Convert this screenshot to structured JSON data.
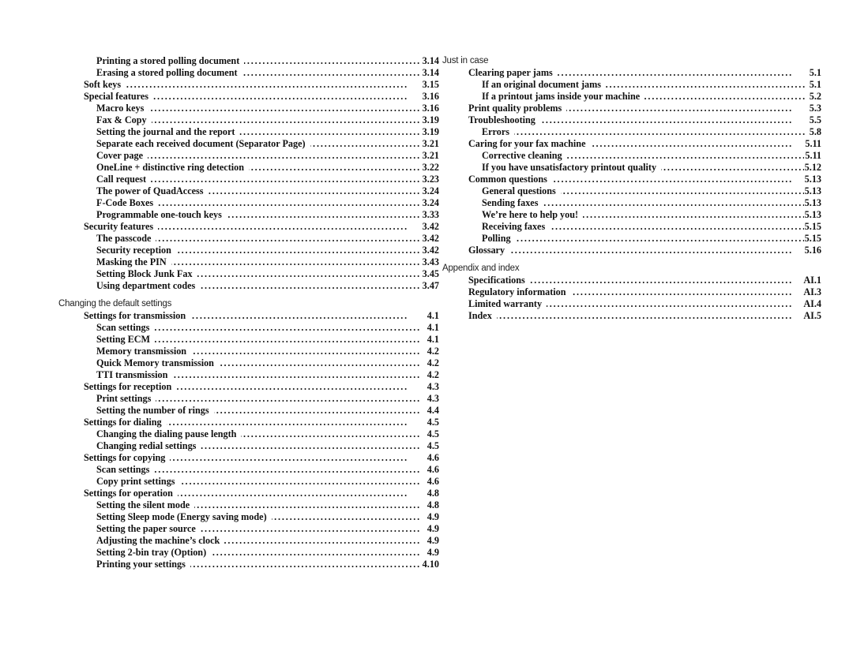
{
  "left_column": {
    "continued_entries": [
      {
        "level": 2,
        "title": "Printing a stored polling document",
        "page": "3.14"
      },
      {
        "level": 2,
        "title": "Erasing a stored polling document",
        "page": "3.14"
      },
      {
        "level": 1,
        "title": "Soft keys",
        "page": "3.15"
      },
      {
        "level": 1,
        "title": "Special features",
        "page": "3.16"
      },
      {
        "level": 2,
        "title": "Macro keys",
        "page": "3.16"
      },
      {
        "level": 2,
        "title": "Fax & Copy",
        "page": "3.19"
      },
      {
        "level": 2,
        "title": "Setting the journal and the report",
        "page": "3.19"
      },
      {
        "level": 2,
        "title": "Separate each received document (Separator Page)",
        "page": "3.21"
      },
      {
        "level": 2,
        "title": "Cover page",
        "page": "3.21"
      },
      {
        "level": 2,
        "title": "OneLine + distinctive ring detection",
        "page": "3.22"
      },
      {
        "level": 2,
        "title": "Call request",
        "page": "3.23"
      },
      {
        "level": 2,
        "title": "The power of QuadAccess",
        "page": "3.24"
      },
      {
        "level": 2,
        "title": "F-Code Boxes",
        "page": "3.24"
      },
      {
        "level": 2,
        "title": "Programmable one-touch keys",
        "page": "3.33"
      },
      {
        "level": 1,
        "title": "Security features",
        "page": "3.42"
      },
      {
        "level": 2,
        "title": "The passcode",
        "page": "3.42"
      },
      {
        "level": 2,
        "title": "Security reception",
        "page": "3.42"
      },
      {
        "level": 2,
        "title": "Masking the PIN",
        "page": "3.43"
      },
      {
        "level": 2,
        "title": "Setting Block Junk Fax",
        "page": "3.45"
      },
      {
        "level": 2,
        "title": "Using department codes",
        "page": "3.47"
      }
    ],
    "section": {
      "heading": "Changing the default settings",
      "entries": [
        {
          "level": 1,
          "title": "Settings for transmission",
          "page": "4.1"
        },
        {
          "level": 2,
          "title": "Scan settings",
          "page": "4.1"
        },
        {
          "level": 2,
          "title": "Setting ECM",
          "page": "4.1"
        },
        {
          "level": 2,
          "title": "Memory transmission",
          "page": "4.2"
        },
        {
          "level": 2,
          "title": "Quick Memory transmission",
          "page": "4.2"
        },
        {
          "level": 2,
          "title": "TTI transmission",
          "page": "4.2"
        },
        {
          "level": 1,
          "title": "Settings for reception",
          "page": "4.3"
        },
        {
          "level": 2,
          "title": "Print settings",
          "page": "4.3"
        },
        {
          "level": 2,
          "title": "Setting the number of rings",
          "page": "4.4"
        },
        {
          "level": 1,
          "title": "Settings for dialing",
          "page": "4.5"
        },
        {
          "level": 2,
          "title": "Changing the dialing pause length",
          "page": "4.5"
        },
        {
          "level": 2,
          "title": "Changing redial settings",
          "page": "4.5"
        },
        {
          "level": 1,
          "title": "Settings for copying",
          "page": "4.6"
        },
        {
          "level": 2,
          "title": "Scan settings",
          "page": "4.6"
        },
        {
          "level": 2,
          "title": "Copy print settings",
          "page": "4.6"
        },
        {
          "level": 1,
          "title": "Settings for operation",
          "page": "4.8"
        },
        {
          "level": 2,
          "title": "Setting the silent mode",
          "page": "4.8"
        },
        {
          "level": 2,
          "title": "Setting Sleep mode (Energy saving mode)",
          "page": "4.9"
        },
        {
          "level": 2,
          "title": "Setting the paper source",
          "page": "4.9"
        },
        {
          "level": 2,
          "title": "Adjusting the machine’s clock",
          "page": "4.9"
        },
        {
          "level": 2,
          "title": "Setting 2-bin tray (Option)",
          "page": "4.9"
        },
        {
          "level": 2,
          "title": "Printing your settings",
          "page": "4.10"
        }
      ]
    }
  },
  "right_column": {
    "sections": [
      {
        "heading": "Just in case",
        "entries": [
          {
            "level": 1,
            "title": "Clearing paper jams",
            "page": "5.1"
          },
          {
            "level": 2,
            "title": "If an original document jams",
            "page": "5.1"
          },
          {
            "level": 2,
            "title": "If a printout jams inside your machine",
            "page": "5.2"
          },
          {
            "level": 1,
            "title": "Print quality problems",
            "page": "5.3"
          },
          {
            "level": 1,
            "title": "Troubleshooting",
            "page": "5.5"
          },
          {
            "level": 2,
            "title": "Errors",
            "page": "5.8"
          },
          {
            "level": 1,
            "title": "Caring for your fax machine",
            "page": "5.11"
          },
          {
            "level": 2,
            "title": "Corrective cleaning",
            "page": "5.11"
          },
          {
            "level": 2,
            "title": "If you have unsatisfactory printout quality",
            "page": "5.12"
          },
          {
            "level": 1,
            "title": "Common questions",
            "page": "5.13"
          },
          {
            "level": 2,
            "title": "General questions",
            "page": "5.13"
          },
          {
            "level": 2,
            "title": "Sending faxes",
            "page": "5.13"
          },
          {
            "level": 2,
            "title": "We’re here to help you!",
            "page": "5.13"
          },
          {
            "level": 2,
            "title": "Receiving faxes",
            "page": "5.15"
          },
          {
            "level": 2,
            "title": "Polling",
            "page": "5.15"
          },
          {
            "level": 1,
            "title": "Glossary",
            "page": "5.16"
          }
        ]
      },
      {
        "heading": "Appendix and index",
        "entries": [
          {
            "level": 1,
            "title": "Specifications",
            "page": "AI.1"
          },
          {
            "level": 1,
            "title": "Regulatory information",
            "page": "AI.3"
          },
          {
            "level": 1,
            "title": "Limited warranty",
            "page": "AI.4"
          },
          {
            "level": 1,
            "title": "Index",
            "page": "AI.5"
          }
        ]
      }
    ]
  }
}
